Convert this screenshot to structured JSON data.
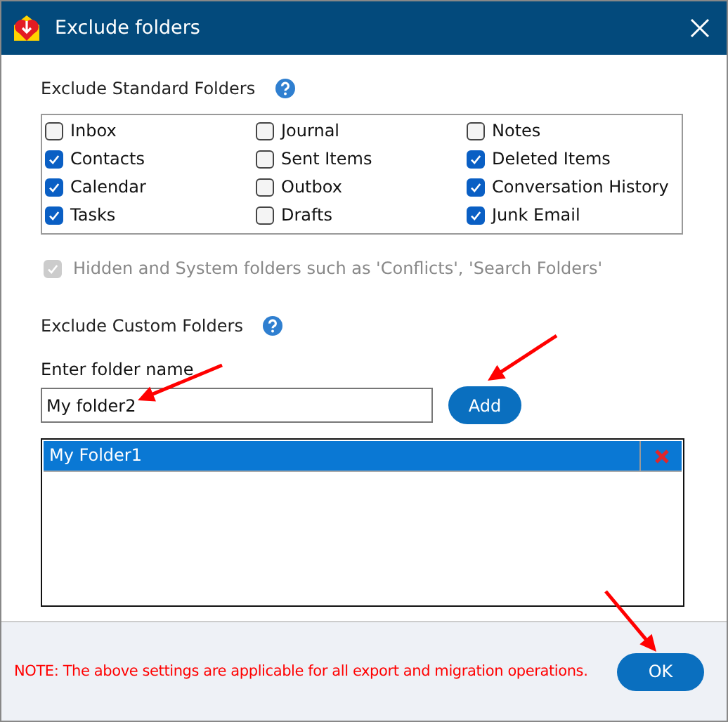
{
  "window": {
    "title": "Exclude folders"
  },
  "standard_folders": {
    "heading": "Exclude Standard Folders",
    "items": [
      {
        "label": "Inbox",
        "checked": false
      },
      {
        "label": "Journal",
        "checked": false
      },
      {
        "label": "Notes",
        "checked": false
      },
      {
        "label": "Contacts",
        "checked": true
      },
      {
        "label": "Sent Items",
        "checked": false
      },
      {
        "label": "Deleted Items",
        "checked": true
      },
      {
        "label": "Calendar",
        "checked": true
      },
      {
        "label": "Outbox",
        "checked": false
      },
      {
        "label": "Conversation History",
        "checked": true
      },
      {
        "label": "Tasks",
        "checked": true
      },
      {
        "label": "Drafts",
        "checked": false
      },
      {
        "label": "Junk Email",
        "checked": true
      }
    ]
  },
  "hidden_option": {
    "label": "Hidden and System folders such as 'Conflicts', 'Search Folders'",
    "checked": true,
    "disabled": true
  },
  "custom_folders": {
    "heading": "Exclude Custom Folders",
    "field_label": "Enter folder name",
    "value": "My folder2",
    "add_button": "Add",
    "items": [
      {
        "name": "My Folder1",
        "selected": true
      }
    ]
  },
  "footer": {
    "note": "NOTE: The above settings are applicable for all export and migration operations.",
    "ok_button": "OK"
  }
}
